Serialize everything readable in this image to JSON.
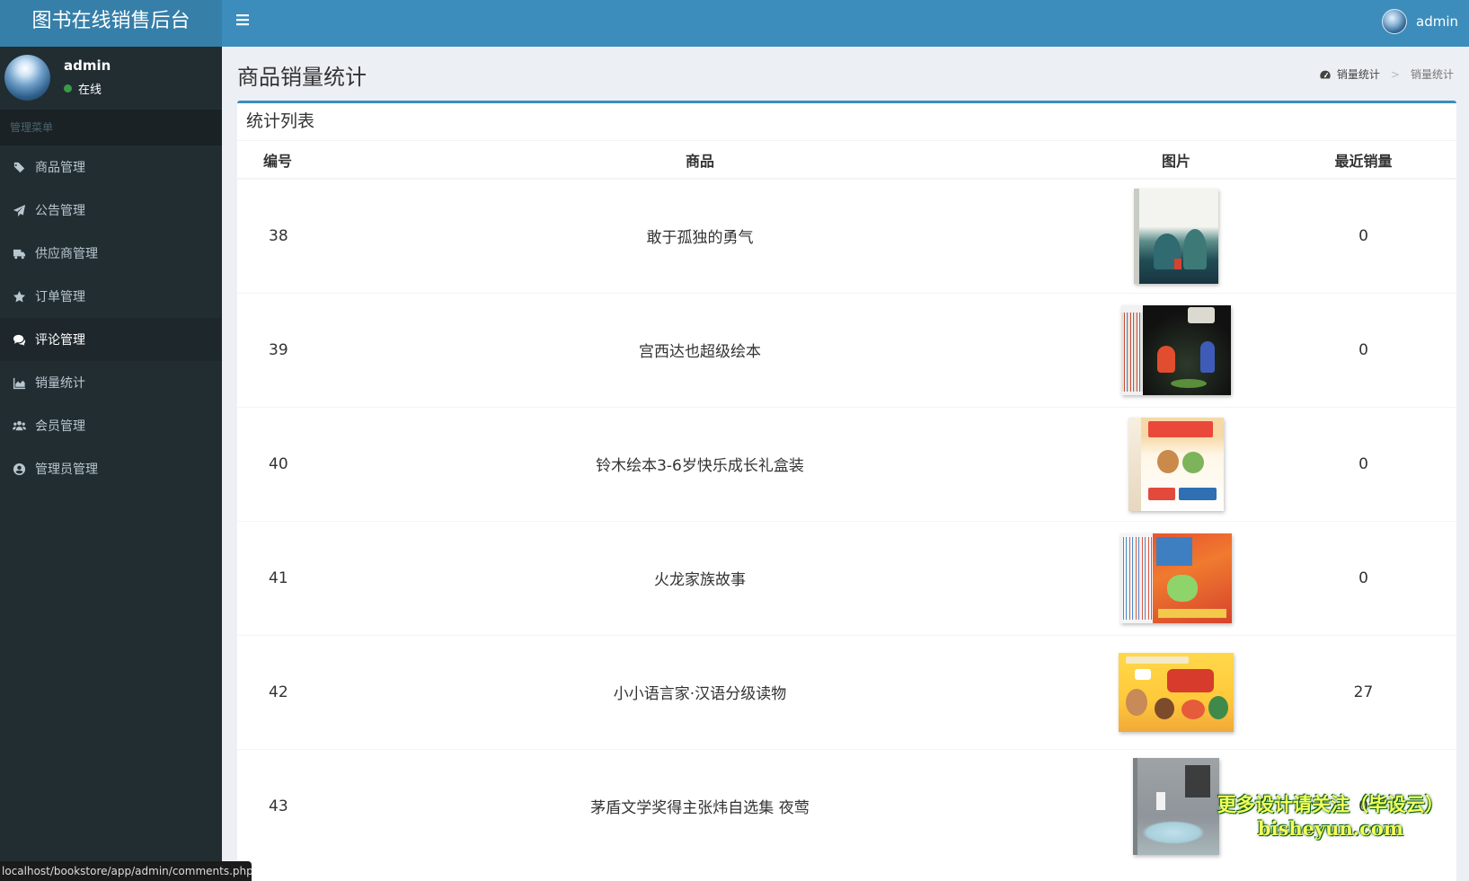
{
  "app": {
    "title": "图书在线销售后台"
  },
  "header": {
    "toggle_icon": "bars-icon",
    "user_name": "admin"
  },
  "sidebar": {
    "user_name": "admin",
    "status": "在线",
    "menu_header": "管理菜单",
    "items": [
      {
        "label": "商品管理",
        "icon": "tags-icon"
      },
      {
        "label": "公告管理",
        "icon": "paper-plane-icon"
      },
      {
        "label": "供应商管理",
        "icon": "truck-icon"
      },
      {
        "label": "订单管理",
        "icon": "star-icon"
      },
      {
        "label": "评论管理",
        "icon": "comments-icon",
        "active": true
      },
      {
        "label": "销量统计",
        "icon": "area-chart-icon"
      },
      {
        "label": "会员管理",
        "icon": "users-icon"
      },
      {
        "label": "管理员管理",
        "icon": "user-circle-icon"
      }
    ]
  },
  "content": {
    "page_title": "商品销量统计",
    "breadcrumb": [
      "销量统计",
      "销量统计"
    ],
    "breadcrumb_separator": ">",
    "box_title": "统计列表",
    "table": {
      "columns": [
        "编号",
        "商品",
        "图片",
        "最近销量"
      ],
      "rows": [
        {
          "id": "38",
          "name": "敢于孤独的勇气",
          "sales": "0"
        },
        {
          "id": "39",
          "name": "宫西达也超级绘本",
          "sales": "0"
        },
        {
          "id": "40",
          "name": "铃木绘本3-6岁快乐成长礼盒装",
          "sales": "0"
        },
        {
          "id": "41",
          "name": "火龙家族故事",
          "sales": "0"
        },
        {
          "id": "42",
          "name": "小小语言家·汉语分级读物",
          "sales": "27"
        },
        {
          "id": "43",
          "name": "茅盾文学奖得主张炜自选集 夜莺",
          "sales": "0"
        }
      ]
    }
  },
  "statusbar": {
    "url": "localhost/bookstore/app/admin/comments.php"
  },
  "watermark": {
    "line1": "更多设计请关注（毕设云）",
    "line2": "bisheyun.com"
  },
  "colors": {
    "primary": "#3c8dbc",
    "logo_bg": "#367fa9",
    "sidebar_bg": "#222d32",
    "content_bg": "#ecf0f5"
  }
}
